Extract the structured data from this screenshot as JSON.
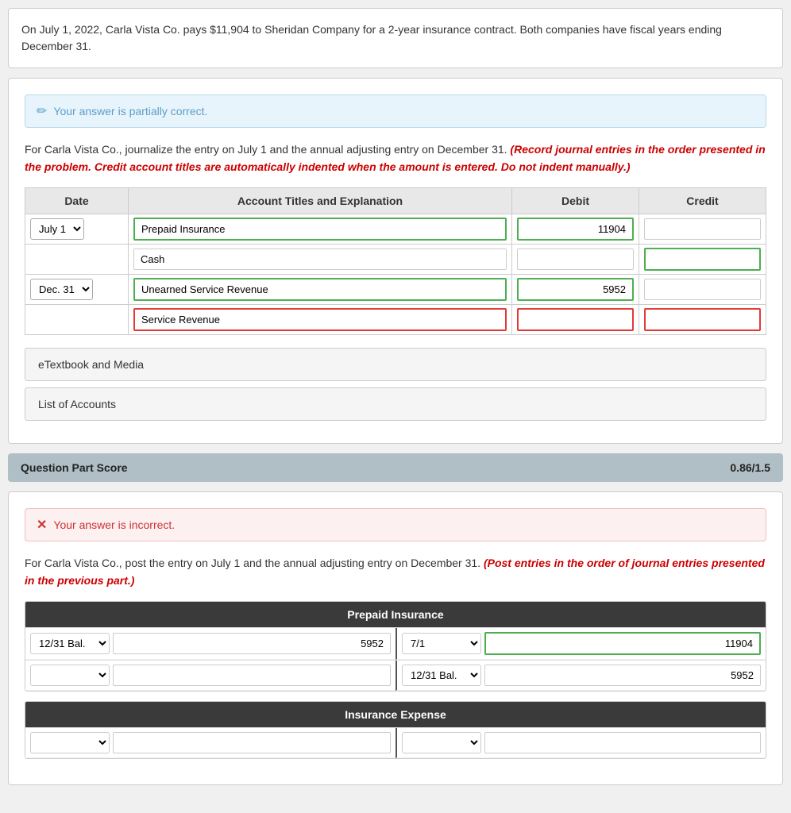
{
  "problem": {
    "text": "On July 1, 2022, Carla Vista Co. pays $11,904 to Sheridan Company for a 2-year insurance contract. Both companies have fiscal years ending December 31."
  },
  "part1": {
    "alert": {
      "icon": "✏",
      "text": "Your answer is partially correct."
    },
    "instruction": "For Carla Vista Co., journalize the entry on July 1 and the annual adjusting entry on December 31.",
    "instruction_bold": "(Record journal entries in the order presented in the problem. Credit account titles are automatically indented when the amount is entered. Do not indent manually.)",
    "table": {
      "headers": [
        "Date",
        "Account Titles and Explanation",
        "Debit",
        "Credit"
      ],
      "rows": [
        {
          "date": "July 1",
          "entries": [
            {
              "account": "Prepaid Insurance",
              "debit": "11904",
              "credit": "",
              "debit_class": "green-border",
              "credit_class": "normal-border"
            },
            {
              "account": "Cash",
              "debit": "",
              "credit": "",
              "debit_class": "normal-border",
              "credit_class": "green-border"
            }
          ]
        },
        {
          "date": "Dec. 31",
          "entries": [
            {
              "account": "Unearned Service Revenue",
              "debit": "5952",
              "credit": "",
              "debit_class": "green-border",
              "credit_class": "normal-border"
            },
            {
              "account": "Service Revenue",
              "debit": "",
              "credit": "",
              "debit_class": "red-border",
              "credit_class": "red-border"
            }
          ]
        }
      ]
    },
    "etextbook_label": "eTextbook and Media",
    "list_accounts_label": "List of Accounts"
  },
  "score": {
    "label": "Question Part Score",
    "value": "0.86/1.5"
  },
  "part2": {
    "alert": {
      "icon": "✕",
      "text": "Your answer is incorrect."
    },
    "instruction": "For Carla Vista Co., post the entry on July 1 and the annual adjusting entry on December 31.",
    "instruction_bold": "(Post entries in the order of journal entries presented in the previous part.)",
    "prepaid_insurance": {
      "title": "Prepaid Insurance",
      "rows": [
        {
          "left_date": "12/31 Bal.",
          "left_amount": "5952",
          "right_date": "7/1",
          "right_amount": "11904",
          "left_class": "normal",
          "right_class": "green"
        },
        {
          "left_date": "",
          "left_amount": "",
          "right_date": "12/31 Bal.",
          "right_amount": "5952",
          "left_class": "normal",
          "right_class": "normal"
        }
      ]
    },
    "insurance_expense": {
      "title": "Insurance Expense",
      "rows": [
        {
          "left_date": "",
          "left_amount": "",
          "right_date": "",
          "right_amount": "",
          "left_class": "normal",
          "right_class": "normal"
        }
      ]
    }
  }
}
